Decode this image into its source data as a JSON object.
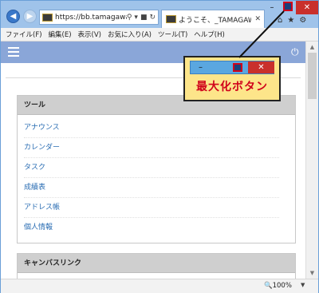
{
  "browser": {
    "address_url": "https://bb.tamagawa....",
    "tab_title": "ようこそ、_TAMAGAWA T...",
    "back_icon": "back-arrow-icon",
    "forward_icon": "forward-arrow-icon",
    "address_icons": [
      "search-icon",
      "chevron-down-icon",
      "lock-icon",
      "refresh-icon"
    ],
    "tool_icons": [
      "home-icon",
      "star-icon",
      "gear-icon"
    ]
  },
  "window_controls": {
    "minimize": "–",
    "close": "✕"
  },
  "menubar": {
    "items": [
      "ファイル(F)",
      "編集(E)",
      "表示(V)",
      "お気に入り(A)",
      "ツール(T)",
      "ヘルプ(H)"
    ]
  },
  "app_header": {
    "menu_icon": "hamburger-icon",
    "power_icon": "power-icon"
  },
  "tools_panel": {
    "title": "ツール",
    "links": [
      "アナウンス",
      "カレンダー",
      "タスク",
      "成績表",
      "アドレス帳",
      "個人情報"
    ]
  },
  "canvas_panel": {
    "title": "キャンバスリンク"
  },
  "statusbar": {
    "zoom": "100%"
  },
  "callout": {
    "label": "最大化ボタン",
    "minimize": "–",
    "close": "✕"
  },
  "colors": {
    "app_header": "#8aa6d8",
    "close_button": "#c9302c",
    "callout_bg": "#fde58a",
    "callout_text": "#d0021b",
    "link": "#2a6db3"
  }
}
